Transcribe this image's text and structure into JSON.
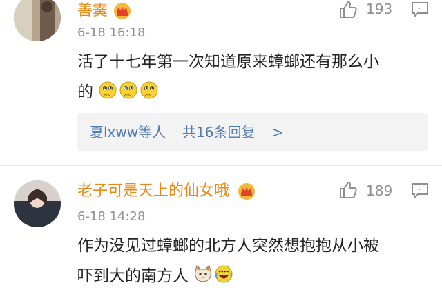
{
  "comments": [
    {
      "username": "善霙",
      "timestamp": "6-18 16:18",
      "likes": "193",
      "text_line1": "活了十七年第一次知道原来蟑螂还有那么小",
      "text_line2": "的",
      "emojis": [
        "thinking-emoji",
        "thinking-emoji",
        "thinking-emoji"
      ],
      "reply_summary": {
        "users": "夏lxww等人",
        "count": "共16条回复",
        "arrow": ">"
      }
    },
    {
      "username": "老子可是天上的仙女哦",
      "timestamp": "6-18 14:28",
      "likes": "189",
      "text_line1": "作为没见过蟑螂的北方人突然想抱抱从小被",
      "text_line2": "吓到大的南方人",
      "emojis": [
        "cat-face-emoji",
        "laughing-emoji"
      ]
    }
  ],
  "colors": {
    "username": "#e88a1a",
    "meta": "#8e8e8e",
    "reply_link": "#4f7ab3",
    "reply_bg": "#f3f3f3"
  }
}
